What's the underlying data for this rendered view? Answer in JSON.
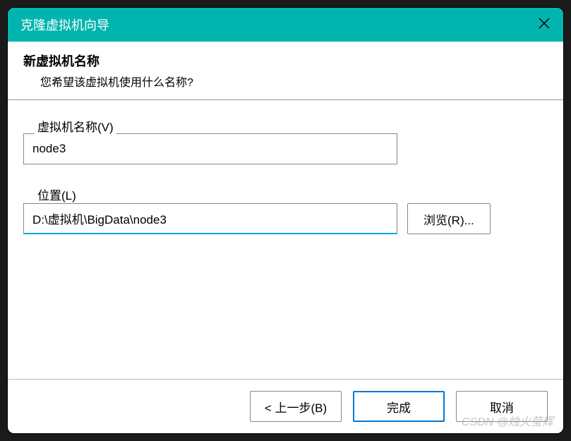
{
  "titlebar": {
    "title": "克隆虚拟机向导"
  },
  "header": {
    "title": "新虚拟机名称",
    "subtitle": "您希望该虚拟机使用什么名称?"
  },
  "fields": {
    "name_label": "虚拟机名称(V)",
    "name_value": "node3",
    "location_label": "位置(L)",
    "location_value": "D:\\虚拟机\\BigData\\node3",
    "browse_label": "浏览(R)..."
  },
  "footer": {
    "back_label": "< 上一步(B)",
    "finish_label": "完成",
    "cancel_label": "取消"
  },
  "watermark": "CSDN @烛火莹辉"
}
